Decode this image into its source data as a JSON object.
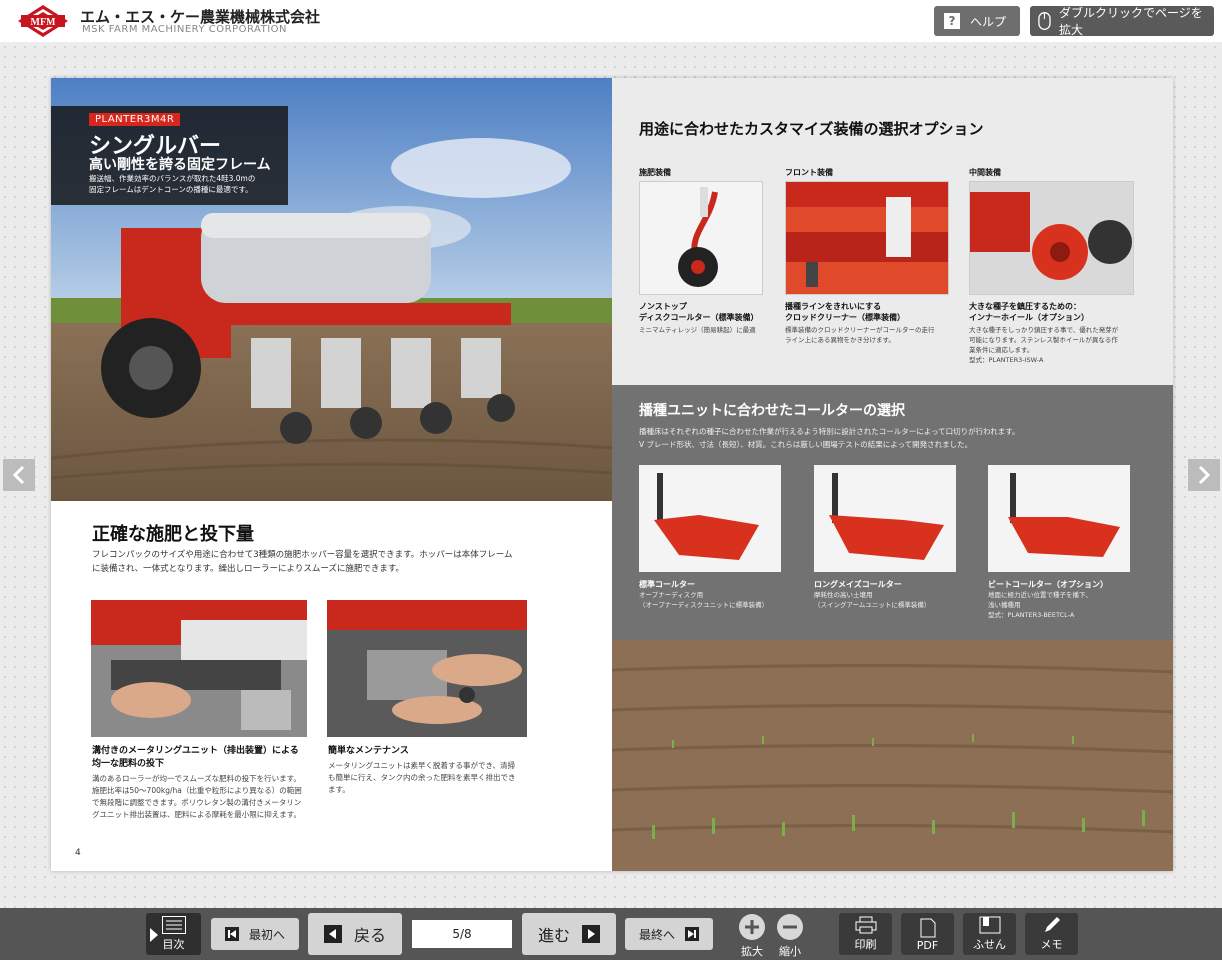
{
  "header": {
    "logo_text": "MFM",
    "company_jp": "エム・エス・ケー農業機械株式会社",
    "company_en": "MSK FARM MACHINERY CORPORATION",
    "help_label": "ヘルプ",
    "help_icon_glyph": "?",
    "zoom_hint_label": "ダブルクリックでページを拡大"
  },
  "left_page": {
    "model_tag": "PLANTER3M4R",
    "hero_title": "シングルバー",
    "hero_subtitle": "高い剛性を誇る固定フレーム",
    "hero_desc": [
      "搬送幅、作業効率のバランスが取れた4畦3.0mの",
      "固定フレームはデントコーンの播種に最適です。"
    ],
    "section_title": "正確な施肥と投下量",
    "section_body": [
      "フレコンパックのサイズや用途に合わせて3種類の施肥ホッパー容量を選択できます。ホッパーは本体フレーム",
      "に装備され、一体式となります。繰出しローラーによりスムーズに施肥できます。"
    ],
    "photo1_title": [
      "溝付きのメータリングユニット（排出装置）による",
      "均一な肥料の投下"
    ],
    "photo1_text": [
      "溝のあるローラーが均一でスムーズな肥料の投下を行います。",
      "施肥比率は50～700kg/ha（比重や粒形により異なる）の範囲",
      "で無段階に調整できます。ポリウレタン製の溝付きメータリン",
      "グユニット排出装置は、肥料による摩耗を最小限に抑えます。"
    ],
    "photo2_title": "簡単なメンテナンス",
    "photo2_text": [
      "メータリングユニットは素早く脱着する事ができ、清掃",
      "も簡単に行え、タンク内の余った肥料を素早く排出でき",
      "ます。"
    ],
    "page_number": "4"
  },
  "right_page": {
    "options_title": "用途に合わせたカスタマイズ装備の選択オプション",
    "options": [
      {
        "category": "施肥装備",
        "title": [
          "ノンストップ",
          "ディスクコールター（標準装備）"
        ],
        "text": [
          "ミニマムティレッジ（簡易耕起）に最適"
        ]
      },
      {
        "category": "フロント装備",
        "title": [
          "播種ラインをきれいにする",
          "クロッドクリーナー（標準装備）"
        ],
        "text": [
          "標準装備のクロッドクリーナーがコールターの走行",
          "ライン上にある異物をかき分けます。"
        ]
      },
      {
        "category": "中間装備",
        "title": [
          "大きな種子を鎮圧するための：",
          "インナーホイール（オプション）"
        ],
        "text": [
          "大きな種子をしっかり鎮圧する事で、優れた発芽が",
          "可能になります。ステンレス製ホイールが異なる作",
          "業条件に適応します。",
          "型式：PLANTER3-ISW-A"
        ]
      }
    ],
    "coulter_title": "播種ユニットに合わせたコールターの選択",
    "coulter_body": [
      "播種床はそれぞれの種子に合わせた作業が行えるよう特別に設計されたコールターによって口切りが行われます。",
      "V ブレード形状、寸法（長短）、材質。これらは厳しい圃場テストの結果によって開発されました。"
    ],
    "coulters": [
      {
        "title": "標準コールター",
        "text": [
          "オープナーディスク用",
          "（オープナーディスクユニットに標準装備）"
        ]
      },
      {
        "title": "ロングメイズコールター",
        "text": [
          "摩耗性の高い土壌用",
          "（スイングアームユニットに標準装備）"
        ]
      },
      {
        "title": "ビートコールター（オプション）",
        "text": [
          "地面に極力近い位置で種子を播下、",
          "浅い播種用",
          "型式：PLANTER3-BEETCL-A"
        ]
      }
    ]
  },
  "toolbar": {
    "toc_label": "目次",
    "first_label": "最初へ",
    "back_label": "戻る",
    "page_indicator": "5/8",
    "next_label": "進む",
    "last_label": "最終へ",
    "zoom_in_label": "拡大",
    "zoom_out_label": "縮小",
    "print_label": "印刷",
    "pdf_label": "PDF",
    "sticky_label": "ふせん",
    "memo_label": "メモ"
  },
  "colors": {
    "accent_red": "#d8261c",
    "toolbar_bg": "#555555",
    "gray_band": "#727272"
  }
}
